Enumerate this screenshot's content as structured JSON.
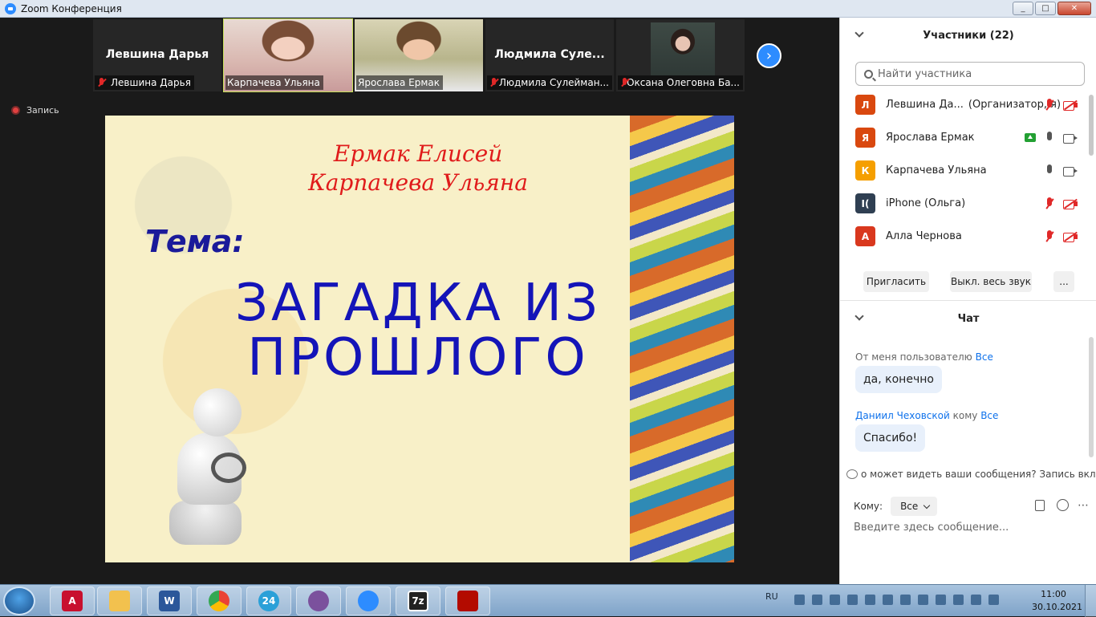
{
  "window": {
    "title": "Zoom Конференция",
    "min": "_",
    "max": "□",
    "close": "✕"
  },
  "gallery": [
    {
      "big_name": "Левшина Дарья",
      "caption": "Левшина Дарья",
      "muted": true
    },
    {
      "big_name": "",
      "caption": "Карпачева Ульяна",
      "muted": false
    },
    {
      "big_name": "",
      "caption": "Ярослава Ермак",
      "muted": false
    },
    {
      "big_name": "Людмила  Суле...",
      "caption": "Людмила Сулейман...",
      "muted": true
    },
    {
      "big_name": "",
      "caption": "Оксана Олеговна Ба...",
      "muted": true
    }
  ],
  "next_arrow": "›",
  "recording": "Запись",
  "slide": {
    "names_line1": "Ермак Елисей",
    "names_line2": "Карпачева Ульяна",
    "tema": "Тема:",
    "title_line1": "ЗАГАДКА ИЗ",
    "title_line2": "ПРОШЛОГО"
  },
  "participants": {
    "header": "Участники (22)",
    "search_placeholder": "Найти участника",
    "list": [
      {
        "initial": "Л",
        "name": "Левшина Да...",
        "extra": "(Организатор, я)",
        "color": "#d9480f"
      },
      {
        "initial": "Я",
        "name": "Ярослава Ермак",
        "extra": "",
        "color": "#d9480f"
      },
      {
        "initial": "К",
        "name": "Карпачева Ульяна",
        "extra": "",
        "color": "#f59f00"
      },
      {
        "initial": "I(",
        "name": "iPhone (Ольга)",
        "extra": "",
        "color": "#2f3f52"
      },
      {
        "initial": "А",
        "name": "Алла Чернова",
        "extra": "",
        "color": "#d9381e"
      }
    ],
    "invite": "Пригласить",
    "mute_all": "Выкл. весь звук",
    "more": "..."
  },
  "chat": {
    "header": "Чат",
    "messages": [
      {
        "from": "От меня пользователю",
        "to": "Все",
        "text": "да, конечно"
      },
      {
        "from": "Даниил Чеховской",
        "mid": "кому",
        "to": "Все",
        "text": "Спасибо!"
      }
    ],
    "visibility": "о может видеть ваши сообщения? Запись включе",
    "to_label": "Кому:",
    "to_value": "Все",
    "input_placeholder": "Введите здесь сообщение..."
  },
  "taskbar": {
    "lang": "RU",
    "time": "11:00",
    "date": "30.10.2021",
    "apps": [
      {
        "label": "A",
        "color": "#c8102e"
      },
      {
        "label": "",
        "color": "#f2c14e"
      },
      {
        "label": "W",
        "color": "#2b579a"
      },
      {
        "label": "",
        "color": "#34a853"
      },
      {
        "label": "24",
        "color": "#2aa0d8"
      },
      {
        "label": "",
        "color": "#7b519d"
      },
      {
        "label": "",
        "color": "#2d8cff"
      },
      {
        "label": "7z",
        "color": "#222222"
      },
      {
        "label": "",
        "color": "#b30b00"
      }
    ]
  }
}
